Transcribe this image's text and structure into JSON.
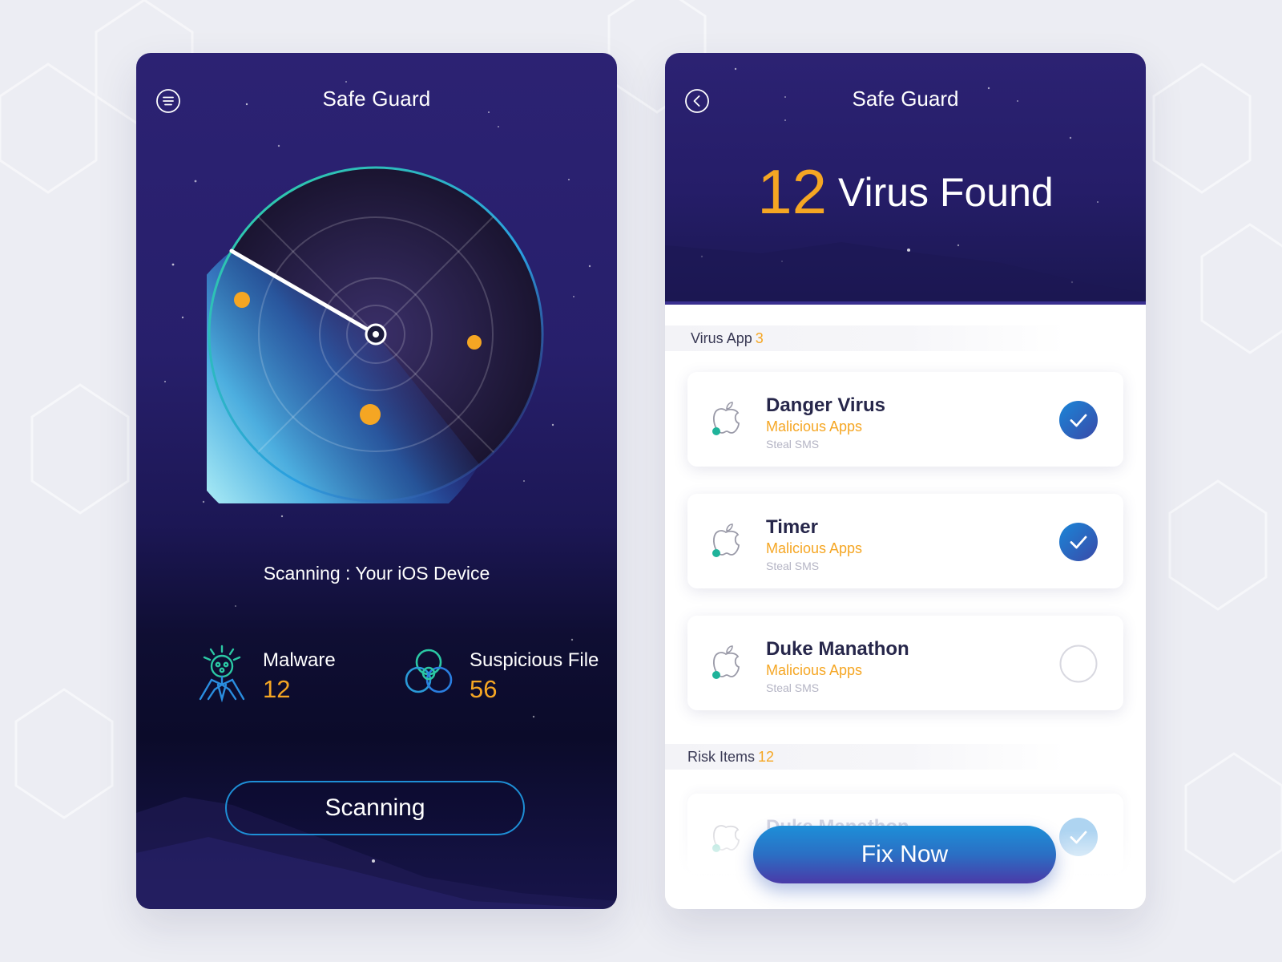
{
  "scanner": {
    "title": "Safe Guard",
    "scan_status": "Scanning : Your iOS Device",
    "stats": {
      "malware": {
        "label": "Malware",
        "value": "12"
      },
      "suspicious": {
        "label": "Suspicious File",
        "value": "56"
      }
    },
    "scan_button": "Scanning"
  },
  "results": {
    "title": "Safe Guard",
    "virus_count": "12",
    "virus_found_text": "Virus Found",
    "virus_app_section": {
      "label": "Virus App",
      "count": "3"
    },
    "apps": [
      {
        "name": "Danger Virus",
        "category": "Malicious Apps",
        "detail": "Steal SMS",
        "checked": true
      },
      {
        "name": "Timer",
        "category": "Malicious Apps",
        "detail": "Steal SMS",
        "checked": true
      },
      {
        "name": "Duke Manathon",
        "category": "Malicious Apps",
        "detail": "Steal SMS",
        "checked": false
      }
    ],
    "risk_section": {
      "label": "Risk Items",
      "count": "12"
    },
    "risk_items": [
      {
        "name": "Duke Manathon",
        "checked": true
      }
    ],
    "fix_button": "Fix Now"
  },
  "colors": {
    "accent_orange": "#f5a623",
    "navy": "#2c2273",
    "check_blue": "#1f72c8",
    "button_blue": "#1d8fd8"
  },
  "icons": [
    "menu-icon",
    "back-icon",
    "apple-icon",
    "checkmark-icon",
    "malware-bug-icon",
    "biohazard-icon"
  ]
}
